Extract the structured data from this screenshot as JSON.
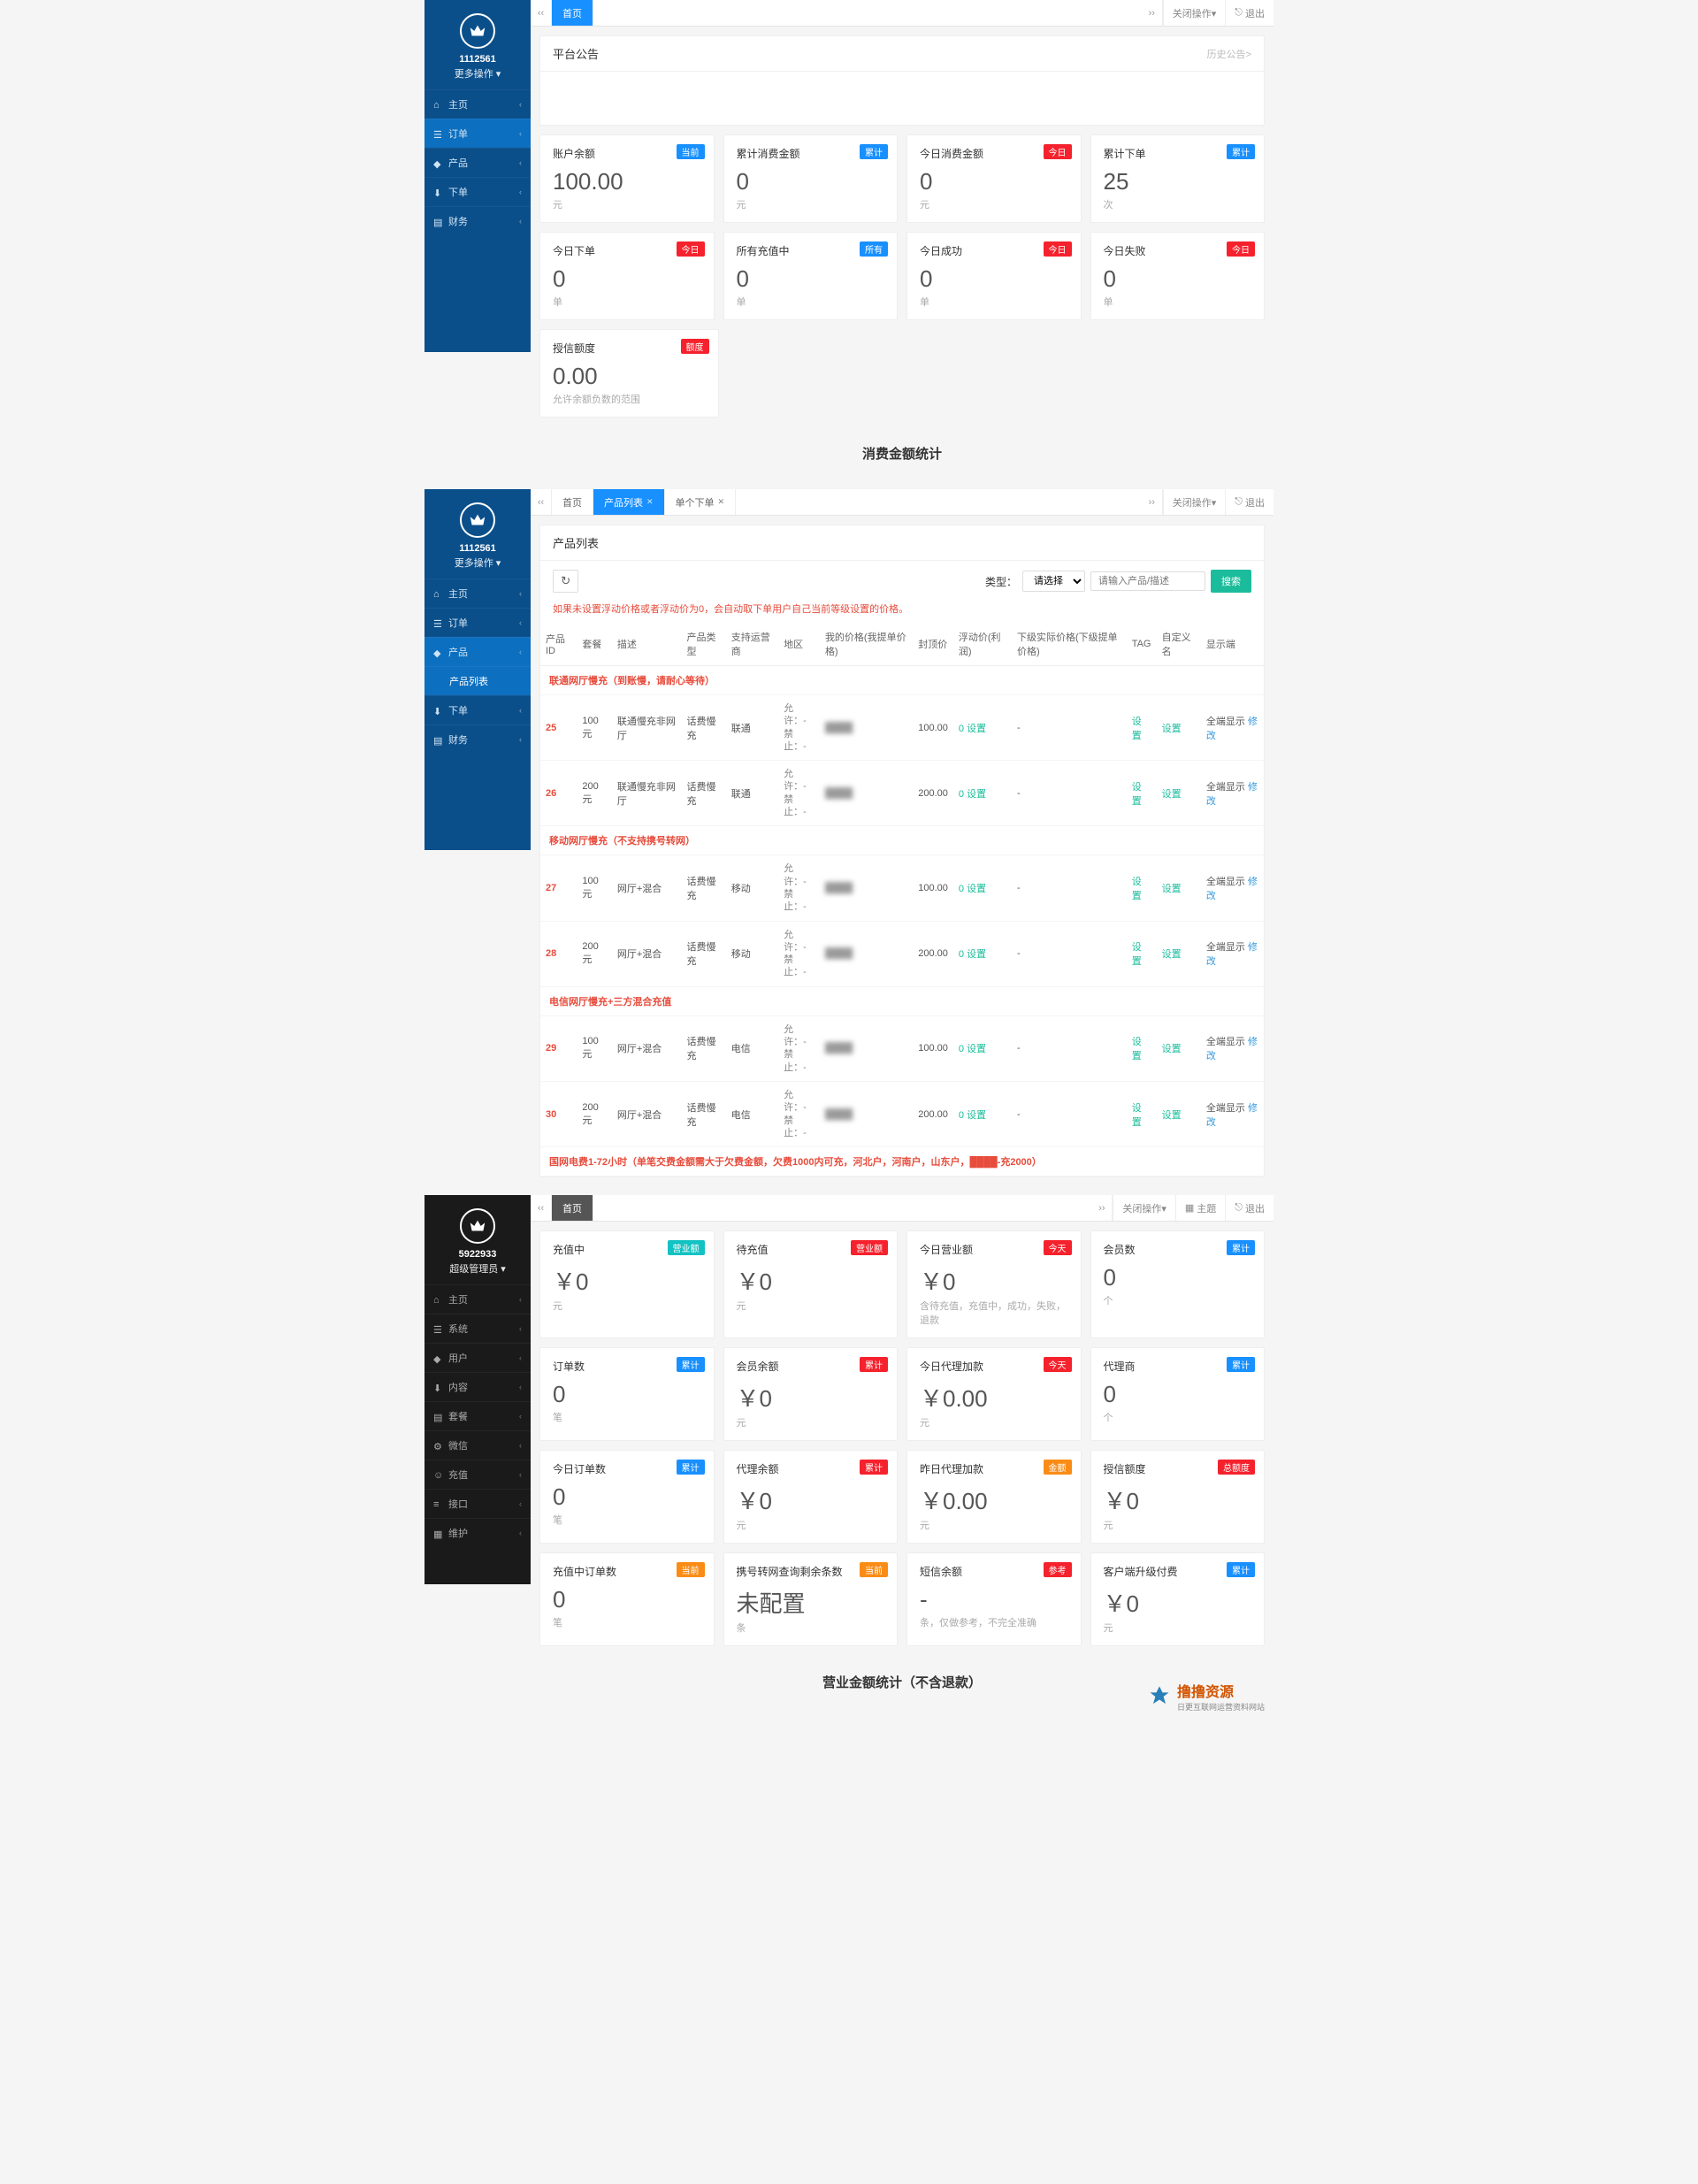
{
  "s1": {
    "uid": "1112561",
    "more": "更多操作 ▾",
    "nav": [
      "主页",
      "订单",
      "产品",
      "下单",
      "财务"
    ],
    "tabs": {
      "home": "首页"
    },
    "topright": {
      "close": "关闭操作▾",
      "exit": "退出"
    },
    "notice": {
      "title": "平台公告",
      "history": "历史公告>"
    },
    "cards": [
      {
        "t": "账户余额",
        "b": "当前",
        "bc": "b-blue",
        "v": "100.00",
        "u": "元"
      },
      {
        "t": "累计消费金额",
        "b": "累计",
        "bc": "b-blue",
        "v": "0",
        "u": "元"
      },
      {
        "t": "今日消费金额",
        "b": "今日",
        "bc": "b-red",
        "v": "0",
        "u": "元"
      },
      {
        "t": "累计下单",
        "b": "累计",
        "bc": "b-blue",
        "v": "25",
        "u": "次"
      },
      {
        "t": "今日下单",
        "b": "今日",
        "bc": "b-red",
        "v": "0",
        "u": "单"
      },
      {
        "t": "所有充值中",
        "b": "所有",
        "bc": "b-blue",
        "v": "0",
        "u": "单"
      },
      {
        "t": "今日成功",
        "b": "今日",
        "bc": "b-red",
        "v": "0",
        "u": "单"
      },
      {
        "t": "今日失败",
        "b": "今日",
        "bc": "b-red",
        "v": "0",
        "u": "单"
      }
    ],
    "credit": {
      "t": "授信额度",
      "b": "额度",
      "bc": "b-red",
      "v": "0.00",
      "u": "允许余额负数的范围"
    },
    "section": "消费金额统计"
  },
  "s2": {
    "uid": "1112561",
    "more": "更多操作 ▾",
    "nav": [
      "主页",
      "订单",
      "产品",
      "下单",
      "财务"
    ],
    "subnav": "产品列表",
    "tabs": {
      "home": "首页",
      "list": "产品列表",
      "order": "单个下单"
    },
    "topright": {
      "close": "关闭操作▾",
      "exit": "退出"
    },
    "panelTitle": "产品列表",
    "typeLabel": "类型：",
    "selPlaceholder": "请选择",
    "searchPlaceholder": "请输入产品/描述",
    "searchBtn": "搜索",
    "warn": "如果未设置浮动价格或者浮动价为0，会自动取下单用户自己当前等级设置的价格。",
    "cols": [
      "产品ID",
      "套餐",
      "描述",
      "产品类型",
      "支持运营商",
      "地区",
      "我的价格(我提单价格)",
      "封顶价",
      "浮动价(利润)",
      "下级实际价格(下级提单价格)",
      "TAG",
      "自定义名",
      "显示端"
    ],
    "groups": [
      {
        "name": "联通网厅慢充（到账慢，请耐心等待）",
        "rows": [
          {
            "id": "25",
            "pkg": "100元",
            "desc": "联通慢充非网厅",
            "type": "话费慢充",
            "op": "联通",
            "allow": "允许：-",
            "deny": "禁止：-",
            "mine": "████",
            "cap": "100.00",
            "float": "0 设置",
            "set1": "设置",
            "set2": "设置",
            "disp": "全端显示",
            "act": "修改"
          },
          {
            "id": "26",
            "pkg": "200元",
            "desc": "联通慢充非网厅",
            "type": "话费慢充",
            "op": "联通",
            "allow": "允许：-",
            "deny": "禁止：-",
            "mine": "████",
            "cap": "200.00",
            "float": "0 设置",
            "set1": "设置",
            "set2": "设置",
            "disp": "全端显示",
            "act": "修改"
          }
        ]
      },
      {
        "name": "移动网厅慢充（不支持携号转网）",
        "rows": [
          {
            "id": "27",
            "pkg": "100元",
            "desc": "网厅+混合",
            "type": "话费慢充",
            "op": "移动",
            "allow": "允许：-",
            "deny": "禁止：-",
            "mine": "████",
            "cap": "100.00",
            "float": "0 设置",
            "set1": "设置",
            "set2": "设置",
            "disp": "全端显示",
            "act": "修改"
          },
          {
            "id": "28",
            "pkg": "200元",
            "desc": "网厅+混合",
            "type": "话费慢充",
            "op": "移动",
            "allow": "允许：-",
            "deny": "禁止：-",
            "mine": "████",
            "cap": "200.00",
            "float": "0 设置",
            "set1": "设置",
            "set2": "设置",
            "disp": "全端显示",
            "act": "修改"
          }
        ]
      },
      {
        "name": "电信网厅慢充+三方混合充值",
        "rows": [
          {
            "id": "29",
            "pkg": "100元",
            "desc": "网厅+混合",
            "type": "话费慢充",
            "op": "电信",
            "allow": "允许：-",
            "deny": "禁止：-",
            "mine": "████",
            "cap": "100.00",
            "float": "0 设置",
            "set1": "设置",
            "set2": "设置",
            "disp": "全端显示",
            "act": "修改"
          },
          {
            "id": "30",
            "pkg": "200元",
            "desc": "网厅+混合",
            "type": "话费慢充",
            "op": "电信",
            "allow": "允许：-",
            "deny": "禁止：-",
            "mine": "████",
            "cap": "200.00",
            "float": "0 设置",
            "set1": "设置",
            "set2": "设置",
            "disp": "全端显示",
            "act": "修改"
          }
        ]
      },
      {
        "name": "国网电费1-72小时（单笔交费金额需大于欠费金额，欠费1000内可充，河北户，河南户，山东户，████-充2000）",
        "rows": []
      }
    ]
  },
  "s3": {
    "uid": "5922933",
    "role": "超级管理员 ▾",
    "nav": [
      "主页",
      "系统",
      "用户",
      "内容",
      "套餐",
      "微信",
      "充值",
      "接口",
      "维护"
    ],
    "tabs": {
      "home": "首页"
    },
    "topright": {
      "close": "关闭操作▾",
      "theme": "主题",
      "exit": "退出"
    },
    "cards": [
      {
        "t": "充值中",
        "b": "营业额",
        "bc": "b-teal",
        "v": "￥0",
        "u": "元"
      },
      {
        "t": "待充值",
        "b": "营业额",
        "bc": "b-red",
        "v": "￥0",
        "u": "元"
      },
      {
        "t": "今日营业额",
        "b": "今天",
        "bc": "b-red",
        "v": "￥0",
        "u": "含待充值，充值中，成功，失败，退款"
      },
      {
        "t": "会员数",
        "b": "累计",
        "bc": "b-blue",
        "v": "0",
        "u": "个"
      },
      {
        "t": "订单数",
        "b": "累计",
        "bc": "b-blue",
        "v": "0",
        "u": "笔"
      },
      {
        "t": "会员余额",
        "b": "累计",
        "bc": "b-red",
        "v": "￥0",
        "u": "元"
      },
      {
        "t": "今日代理加款",
        "b": "今天",
        "bc": "b-red",
        "v": "￥0.00",
        "u": "元"
      },
      {
        "t": "代理商",
        "b": "累计",
        "bc": "b-blue",
        "v": "0",
        "u": "个"
      },
      {
        "t": "今日订单数",
        "b": "累计",
        "bc": "b-blue",
        "v": "0",
        "u": "笔"
      },
      {
        "t": "代理余额",
        "b": "累计",
        "bc": "b-red",
        "v": "￥0",
        "u": "元"
      },
      {
        "t": "昨日代理加款",
        "b": "金额",
        "bc": "b-orange",
        "v": "￥0.00",
        "u": "元"
      },
      {
        "t": "授信额度",
        "b": "总额度",
        "bc": "b-red",
        "v": "￥0",
        "u": "元"
      },
      {
        "t": "充值中订单数",
        "b": "当前",
        "bc": "b-orange",
        "v": "0",
        "u": "笔"
      },
      {
        "t": "携号转网查询剩余条数",
        "b": "当前",
        "bc": "b-orange",
        "v": "未配置",
        "u": "条"
      },
      {
        "t": "短信余额",
        "b": "参考",
        "bc": "b-red",
        "v": "-",
        "u": "条，仅做参考，不完全准确"
      },
      {
        "t": "客户端升级付费",
        "b": "累计",
        "bc": "b-blue",
        "v": "￥0",
        "u": "元"
      }
    ],
    "section": "营业金额统计（不含退款）",
    "watermark": {
      "brand": "撸撸资源",
      "sub": "日更互联网运营资料网站"
    }
  }
}
